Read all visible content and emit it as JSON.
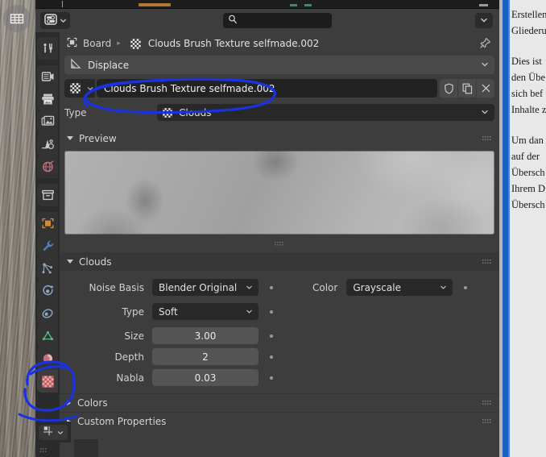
{
  "app": {
    "name": "Blender",
    "editor": "Properties"
  },
  "desktop": {
    "icon_name": "desktop-app-icon"
  },
  "header": {
    "editor_type_icon": "properties-editor-icon",
    "search_placeholder": "",
    "search_value": "",
    "search_icon": "search-icon",
    "overflow_icon": "chevron-down-icon"
  },
  "navtabs": [
    {
      "name": "tool",
      "icon": "tool-icon",
      "active": false
    },
    {
      "name": "render",
      "icon": "render-camera-icon",
      "active": false
    },
    {
      "name": "output",
      "icon": "printer-output-icon",
      "active": false
    },
    {
      "name": "view-layer",
      "icon": "images-layer-icon",
      "active": false
    },
    {
      "name": "scene",
      "icon": "scene-cone-icon",
      "active": false
    },
    {
      "name": "world",
      "icon": "world-globe-icon",
      "active": false
    },
    {
      "name": "collection",
      "icon": "collection-box-icon",
      "active": false
    },
    {
      "name": "object",
      "icon": "object-square-icon",
      "active": false
    },
    {
      "name": "modifiers",
      "icon": "wrench-icon",
      "active": false
    },
    {
      "name": "particles",
      "icon": "particles-icon",
      "active": false
    },
    {
      "name": "physics",
      "icon": "physics-orbit-icon",
      "active": false
    },
    {
      "name": "constraints",
      "icon": "constraint-icon",
      "active": false
    },
    {
      "name": "data",
      "icon": "mesh-data-triangle-icon",
      "active": false
    },
    {
      "name": "material",
      "icon": "material-sphere-icon",
      "active": false
    },
    {
      "name": "texture",
      "icon": "texture-checker-icon",
      "active": true
    }
  ],
  "breadcrumb": {
    "items": [
      {
        "label": "Board",
        "icon": "object-square-icon"
      },
      {
        "label": "Clouds Brush Texture selfmade.002",
        "icon": "texture-checker-icon"
      }
    ],
    "separator": "▸",
    "pin_icon": "pin-icon"
  },
  "context_bar": {
    "label": "Displace",
    "icon": "displace-modifier-icon",
    "chevron": "chevron-down-icon"
  },
  "texture_id": {
    "browse_icon": "texture-checker-icon",
    "browse_chevron_icon": "chevron-down-small-icon",
    "name": "Clouds Brush Texture selfmade.002",
    "buttons": [
      {
        "name": "fake-user",
        "icon": "shield-icon"
      },
      {
        "name": "new-texture",
        "icon": "copy-icon"
      },
      {
        "name": "unlink-texture",
        "icon": "close-x-icon"
      }
    ]
  },
  "type_row": {
    "label": "Type",
    "value": "Clouds",
    "icon": "texture-checker-icon",
    "chevron": "chevron-down-icon"
  },
  "preview_panel": {
    "title": "Preview",
    "expanded": true,
    "grip_icon": "drag-grip-icon"
  },
  "clouds_panel": {
    "title": "Clouds",
    "expanded": true,
    "grip_icon": "drag-grip-icon",
    "fields": [
      {
        "label": "Noise Basis",
        "value": "Blender Original",
        "kind": "dropdown",
        "decorator": "animate-dot"
      },
      {
        "label": "Type",
        "value": "Soft",
        "kind": "dropdown",
        "decorator": "animate-dot"
      },
      {
        "label": "Size",
        "value": "3.00",
        "kind": "slider",
        "decorator": "animate-dot"
      },
      {
        "label": "Depth",
        "value": "2",
        "kind": "slider",
        "decorator": "animate-dot"
      },
      {
        "label": "Nabla",
        "value": "0.03",
        "kind": "slider",
        "decorator": "animate-dot"
      }
    ],
    "right_fields": [
      {
        "label": "Color",
        "value": "Grayscale",
        "kind": "dropdown",
        "decorator": "animate-dot"
      }
    ]
  },
  "collapsed_panels": [
    {
      "title": "Colors",
      "expanded": false,
      "grip_icon": "drag-grip-icon"
    },
    {
      "title": "Custom Properties",
      "expanded": false,
      "grip_icon": "drag-grip-icon"
    }
  ],
  "corner": {
    "editor_icon": "uv-editor-icon",
    "chevron": "chevron-down-icon",
    "grip_icon": "drag-grip-icon"
  },
  "document_pane": {
    "lines": [
      "Erstellen",
      "Gliederu",
      "",
      "Dies ist",
      "den Übe",
      "sich bef",
      "Inhalte z",
      "",
      "Um dan",
      "auf der",
      "Übersch",
      "Ihrem D",
      "Übersch"
    ]
  },
  "colors": {
    "editor_bg": "#3d3d3d",
    "header_bg": "#3d3d3d",
    "nav_bg": "#2b2b2b",
    "field_dark": "#282828",
    "field_grey": "#545454",
    "accent_active": "#4772b3",
    "annotation": "#1a32e0",
    "texture_icon": "#d98a8a",
    "object_icon": "#d08b3c"
  }
}
